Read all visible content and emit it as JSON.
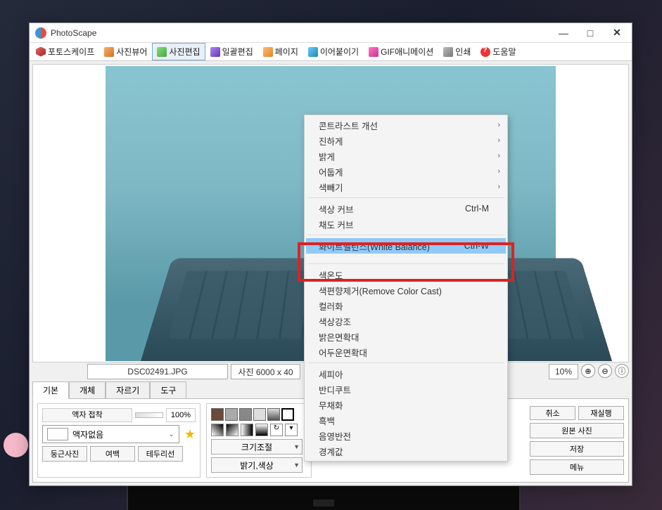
{
  "window": {
    "title": "PhotoScape"
  },
  "toolbar": {
    "photoscape": "포토스케이프",
    "viewer": "사진뷰어",
    "editor": "사진편집",
    "batch": "일괄편집",
    "page": "페이지",
    "combine": "이어붙이기",
    "gif": "GIF애니메이션",
    "print": "인쇄",
    "help": "도움말"
  },
  "info": {
    "filename": "DSC02491.JPG",
    "size": "사진 6000 x 40",
    "zoom": "10%"
  },
  "tabs": {
    "basic": "기본",
    "object": "개체",
    "crop": "자르기",
    "tools": "도구"
  },
  "panel": {
    "frame_label": "액자 접착",
    "pct": "100%",
    "frame_none": "액자없음",
    "round": "둥근사진",
    "margin": "여백",
    "texture": "테두리선",
    "resize": "크기조절",
    "bright": "밝기,색상"
  },
  "right": {
    "undo": "취소",
    "redo": "재실행",
    "original": "원본 사진",
    "save": "저장",
    "menu": "메뉴"
  },
  "menu": {
    "contrast": "콘트라스트 개선",
    "deepen": "진하게",
    "brighten": "밝게",
    "darken": "어둡게",
    "desat": "색빼기",
    "color_curve": "색상 커브",
    "color_curve_sc": "Ctrl-M",
    "sat_curve": "채도 커브",
    "white_balance": "화이트밸런스(White Balance)",
    "white_balance_sc": "Ctrl-W",
    "temperature": "색온도",
    "remove_cast": "색편향제거(Remove Color Cast)",
    "colorize": "컬러화",
    "enhance": "색상강조",
    "bright_expand": "밝은면확대",
    "dark_expand": "어두운면확대",
    "sepia": "세피아",
    "bandicoot": "반디쿠트",
    "cinema": "무채화",
    "bw": "흑백",
    "invert": "음영반전",
    "threshold": "경계값"
  }
}
